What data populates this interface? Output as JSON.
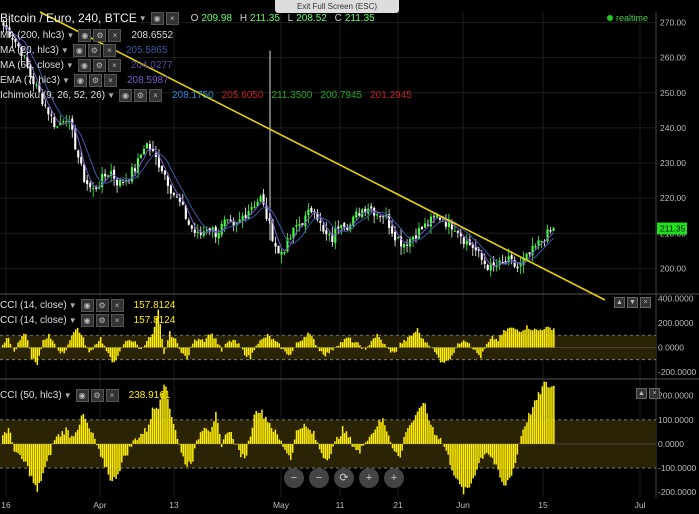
{
  "window": {
    "title": "Bitcoin / Euro, 240, BTCE",
    "exit_fullscreen": "Exit Full Screen (ESC)",
    "realtime": "realtime"
  },
  "ohlc": {
    "o_label": "O",
    "o": "209.98",
    "h_label": "H",
    "h": "211.35",
    "l_label": "L",
    "l": "208.52",
    "c_label": "C",
    "c": "211.35"
  },
  "indicators": [
    {
      "name": "MA (200, hlc3)",
      "value": "208.6552",
      "color": "#dddddd"
    },
    {
      "name": "MA (20, hlc3)",
      "value": "205.5865",
      "color": "#3a5aa8"
    },
    {
      "name": "MA (65, close)",
      "value": "204.0277",
      "color": "#5a4aa8"
    },
    {
      "name": "EMA (7, hlc3)",
      "value": "208.5987",
      "color": "#7a5ac8"
    },
    {
      "name": "Ichimoku (9, 26, 52, 26)",
      "values": [
        "208.1750",
        "205.6050",
        "211.3500",
        "200.7945",
        "201.2945"
      ],
      "colors": [
        "#2a8ad8",
        "#c82020",
        "#22aa22",
        "#22aa22",
        "#c82020"
      ]
    }
  ],
  "cci_panels": [
    {
      "labels": [
        {
          "name": "CCI (14, close)",
          "value": "157.8124"
        },
        {
          "name": "CCI (14, close)",
          "value": "157.8124"
        }
      ]
    },
    {
      "labels": [
        {
          "name": "CCI (50, hlc3)",
          "value": "238.9161"
        }
      ]
    }
  ],
  "nav_buttons": [
    "−",
    "−",
    "⟳",
    "+",
    "+"
  ],
  "colors": {
    "background": "#000000",
    "cci": "#ffee00",
    "trendline": "#e6d200",
    "up": "#44ff44",
    "down": "#ffffff",
    "last_price": "#22dd22"
  },
  "chart_data": [
    {
      "type": "candlestick",
      "title": "Bitcoin / Euro, 240, BTCE",
      "x_ticks": [
        "16",
        "Apr",
        "13",
        "May",
        "11",
        "21",
        "Jun",
        "15",
        "Jul"
      ],
      "y_ticks": [
        200,
        210,
        220,
        230,
        240,
        250,
        260,
        270
      ],
      "ylim": [
        193,
        273
      ],
      "last_price": 211.35,
      "path_close": [
        269,
        266,
        262,
        255,
        250,
        245,
        240,
        244,
        236,
        226,
        222,
        225,
        228,
        224,
        226,
        229,
        236,
        232,
        228,
        222,
        218,
        212,
        209,
        212,
        210,
        213,
        211,
        215,
        218,
        220,
        212,
        204,
        207,
        212,
        214,
        218,
        210,
        208,
        214,
        212,
        216,
        218,
        216,
        215,
        210,
        207,
        209,
        211,
        213,
        215,
        213,
        212,
        208,
        206,
        202,
        200,
        201,
        202,
        200,
        203,
        206,
        209,
        211
      ],
      "trendline": {
        "from": [
          0,
          273
        ],
        "to": [
          1,
          191
        ]
      },
      "ma": [
        {
          "name": "MA (20, hlc3)",
          "color": "#3a5aa8"
        },
        {
          "name": "EMA (7, hlc3)",
          "color": "#7a5ac8"
        }
      ],
      "grid": true
    },
    {
      "type": "bar",
      "name": "CCI (14, close)",
      "y_ticks": [
        -200,
        0,
        200,
        400
      ],
      "ylim": [
        -250,
        430
      ],
      "levels": [
        100,
        -100
      ],
      "bars": [
        30,
        80,
        -40,
        60,
        120,
        -80,
        -150,
        60,
        100,
        40,
        -60,
        -20,
        110,
        160,
        70,
        -50,
        20,
        80,
        -30,
        -120,
        -80,
        30,
        70,
        40,
        -20,
        60,
        100,
        300,
        -60,
        120,
        60,
        -30,
        -100,
        40,
        80,
        60,
        120,
        70,
        -30,
        40,
        60,
        20,
        -50,
        -90,
        30,
        60,
        100,
        60,
        20,
        -40,
        -60,
        30,
        70,
        120,
        60,
        -20,
        -60,
        -30,
        20,
        50,
        80,
        40,
        20,
        -30,
        60,
        100,
        40,
        -20,
        -50,
        30,
        60,
        100,
        150,
        60,
        30,
        -40,
        -110,
        -120,
        -60,
        20,
        70,
        40,
        -30,
        -80,
        20,
        80,
        60,
        130,
        160,
        150,
        140,
        170,
        150,
        140,
        160,
        158
      ]
    },
    {
      "type": "bar",
      "name": "CCI (50, hlc3)",
      "y_ticks": [
        -200,
        -100,
        0,
        100,
        200
      ],
      "ylim": [
        -220,
        265
      ],
      "levels": [
        100,
        -100
      ],
      "bars": [
        40,
        60,
        -20,
        -60,
        -80,
        -140,
        -200,
        -120,
        -60,
        20,
        40,
        60,
        30,
        70,
        120,
        60,
        20,
        -60,
        -100,
        -160,
        -120,
        -60,
        -20,
        20,
        40,
        60,
        140,
        160,
        260,
        150,
        60,
        -40,
        -90,
        -60,
        30,
        80,
        60,
        120,
        -20,
        60,
        30,
        -30,
        -70,
        40,
        150,
        130,
        100,
        60,
        20,
        -20,
        -60,
        50,
        80,
        60,
        40,
        -20,
        -60,
        -40,
        20,
        60,
        30,
        -10,
        -40,
        20,
        40,
        80,
        100,
        40,
        -30,
        -60,
        60,
        90,
        120,
        180,
        100,
        50,
        20,
        -30,
        -100,
        -160,
        -200,
        -180,
        -120,
        -60,
        -30,
        -60,
        -120,
        -180,
        -140,
        -80,
        40,
        100,
        150,
        200,
        250,
        238
      ]
    }
  ]
}
